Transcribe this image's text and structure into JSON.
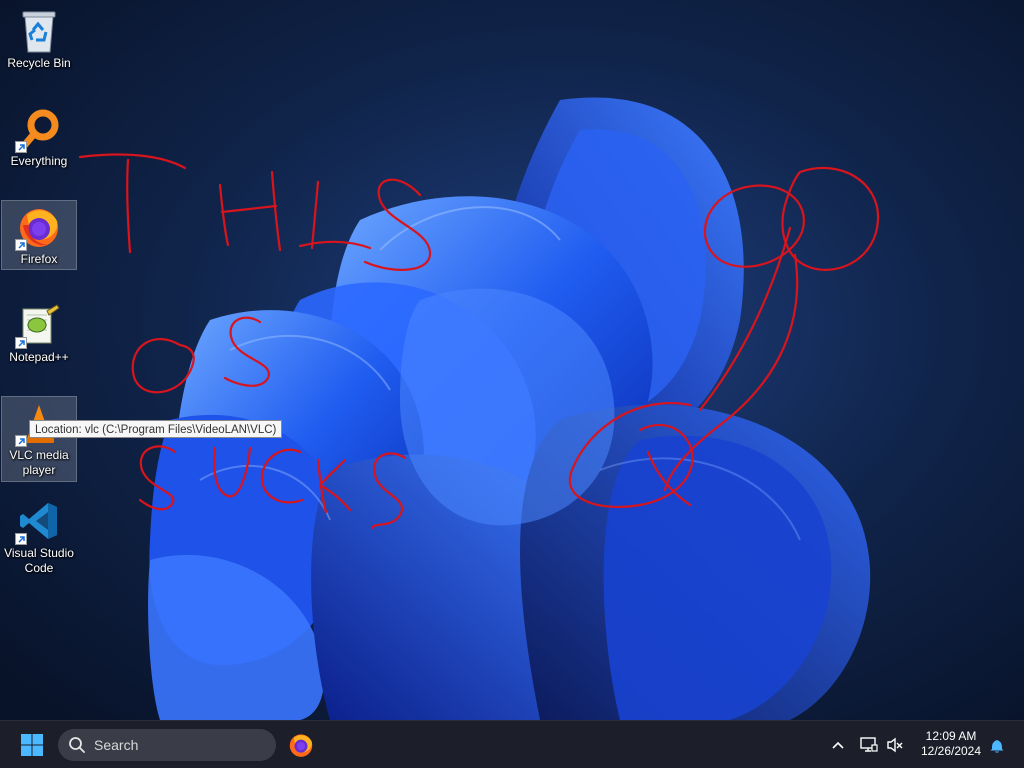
{
  "desktop": {
    "icons": [
      {
        "label": "Recycle Bin",
        "icon": "recycle-bin-icon",
        "shortcut": false
      },
      {
        "label": "Everything",
        "icon": "everything-search-icon",
        "shortcut": true
      },
      {
        "label": "Firefox",
        "icon": "firefox-icon",
        "shortcut": true,
        "selected": true
      },
      {
        "label": "Notepad++",
        "icon": "notepad-plus-plus-icon",
        "shortcut": true
      },
      {
        "label": "VLC media player",
        "icon": "vlc-cone-icon",
        "shortcut": true,
        "selected": true
      },
      {
        "label": "Visual Studio Code",
        "icon": "vscode-icon",
        "shortcut": true
      }
    ],
    "tooltip": "Location: vlc (C:\\Program Files\\VideoLAN\\VLC)",
    "scribble_color": "#d8141c"
  },
  "taskbar": {
    "search_placeholder": "Search",
    "pinned": [
      {
        "name": "Firefox",
        "icon": "firefox-icon"
      }
    ],
    "tray": {
      "time": "12:09 AM",
      "date": "12/26/2024",
      "icons": [
        "chevron-up-icon",
        "network-icon",
        "volume-muted-icon",
        "notification-bell-icon"
      ]
    }
  },
  "colors": {
    "taskbar_bg": "#1c1f2a",
    "accent": "#2f7bf5",
    "wallpaper_dark": "#0b1630"
  }
}
